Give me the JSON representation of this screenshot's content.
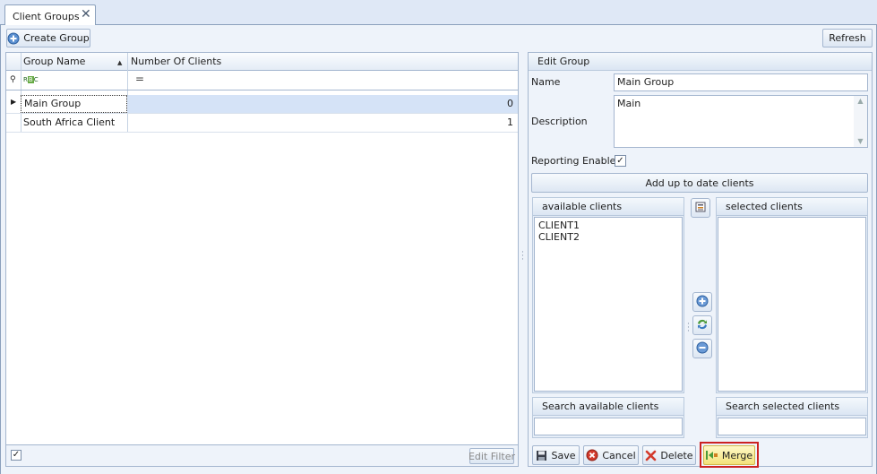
{
  "tab": {
    "title": "Client Groups"
  },
  "toolbar": {
    "create_group": "Create Group",
    "refresh": "Refresh"
  },
  "grid": {
    "columns": [
      "Group Name",
      "Number Of Clients"
    ],
    "filter_icon": "abc-filter-icon",
    "filter_condition": "=",
    "rows": [
      {
        "name": "Main Group",
        "count": "0"
      },
      {
        "name": "South Africa Client",
        "count": "1"
      }
    ],
    "edit_filter": "Edit Filter"
  },
  "edit_group": {
    "title": "Edit Group",
    "name_label": "Name",
    "name_value": "Main Group",
    "description_label": "Description",
    "description_value": "Main",
    "reporting_label": "Reporting Enabled",
    "reporting_checked": true,
    "add_clients": "Add up to date clients",
    "available_title": "available clients",
    "selected_title": "selected clients",
    "available_items": [
      "CLIENT1",
      "CLIENT2"
    ],
    "search_available": "Search available clients",
    "search_selected": "Search selected clients"
  },
  "actions": {
    "save": "Save",
    "cancel": "Cancel",
    "delete": "Delete",
    "merge": "Merge"
  },
  "colors": {
    "accent": "#dfe8f6",
    "border": "#8ba0bc",
    "selection": "#d5e3f7",
    "merge_highlight": "#cc2222"
  }
}
